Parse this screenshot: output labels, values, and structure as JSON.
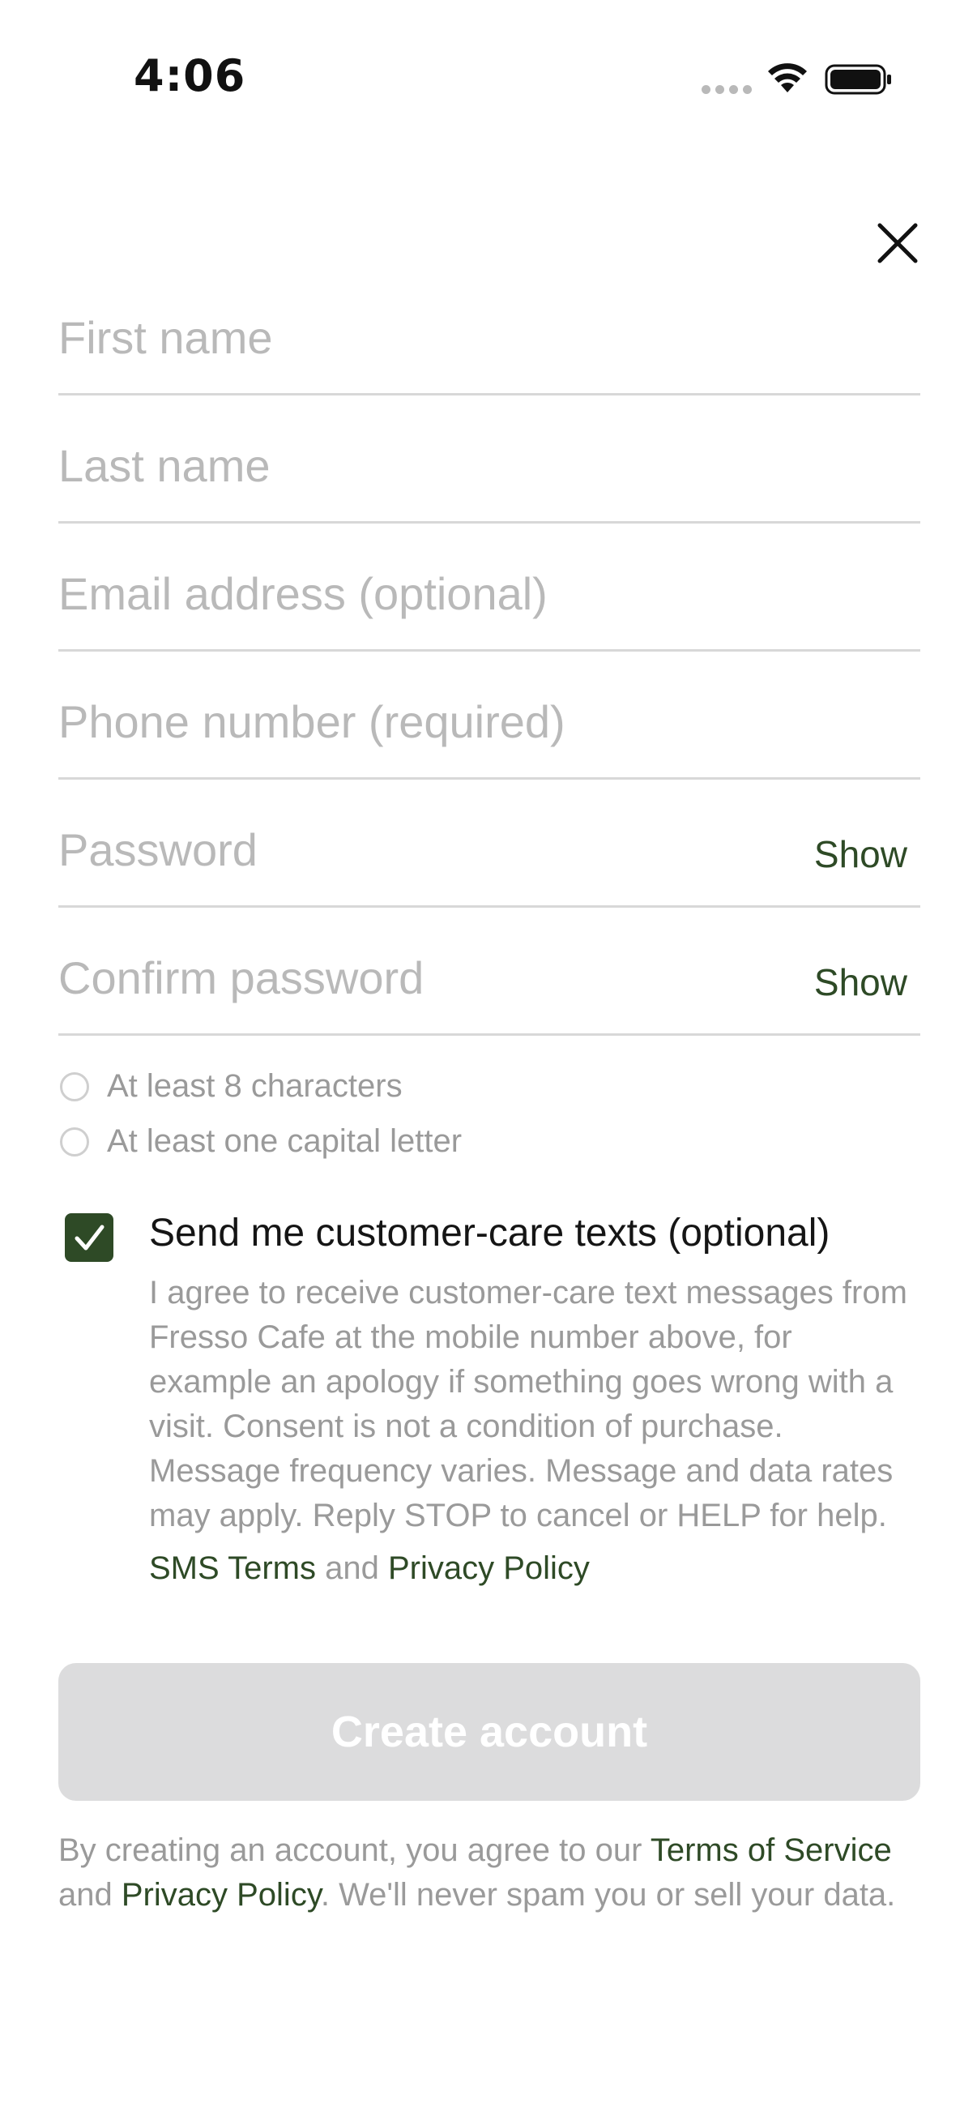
{
  "status_bar": {
    "time": "4:06"
  },
  "form": {
    "first_name_placeholder": "First name",
    "last_name_placeholder": "Last name",
    "email_placeholder": "Email address (optional)",
    "phone_placeholder": "Phone number (required)",
    "password_placeholder": "Password",
    "password_show_label": "Show",
    "confirm_password_placeholder": "Confirm password",
    "confirm_show_label": "Show"
  },
  "password_rules": [
    {
      "label": "At least 8 characters",
      "met": false
    },
    {
      "label": "At least one capital letter",
      "met": false
    }
  ],
  "sms_consent": {
    "checked": true,
    "title": "Send me customer-care texts (optional)",
    "body": "I agree to receive customer-care text messages from Fresso Cafe at the mobile number above, for example an apology if something goes wrong with a visit. Consent is not a condition of purchase. Message frequency varies. Message and data rates may apply. Reply STOP to cancel or HELP for help.",
    "sms_terms_link": "SMS Terms",
    "and_text": "and",
    "privacy_link": "Privacy Policy"
  },
  "create_button": {
    "label": "Create account",
    "enabled": false
  },
  "footer": {
    "prefix": "By creating an account, you agree to our",
    "terms_link": "Terms of Service",
    "and_text": "and",
    "privacy_link": "Privacy Policy",
    "suffix": ". We'll never spam you or sell your data."
  },
  "colors": {
    "accent": "#2e4a26",
    "placeholder": "#b9b9b9",
    "muted_text": "#9a9a9a",
    "disabled_button": "#dcdcdd"
  }
}
